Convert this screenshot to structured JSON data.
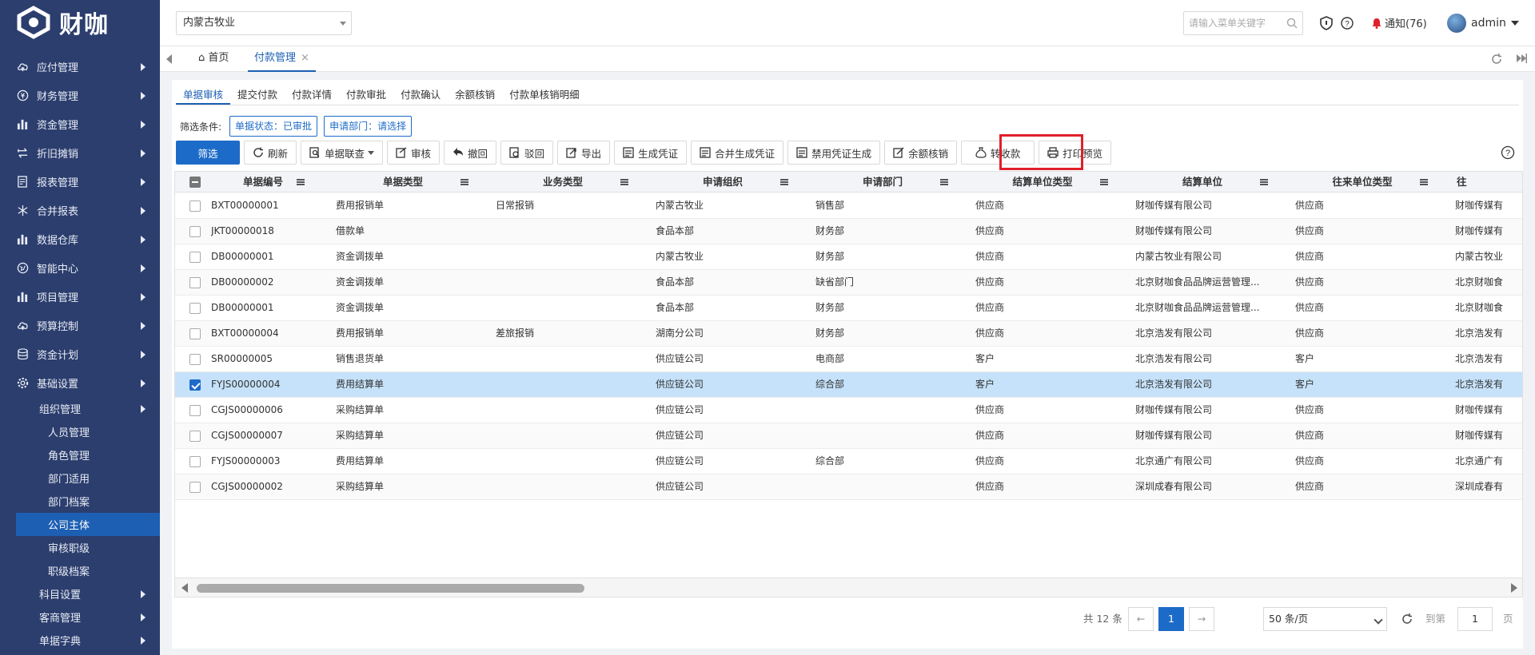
{
  "app": {
    "name": "财咖"
  },
  "sidebar": {
    "top_items": [
      {
        "label": "应付管理",
        "icon": "cloud-icon"
      },
      {
        "label": "财务管理",
        "icon": "coin-icon"
      },
      {
        "label": "资金管理",
        "icon": "bar-chart-icon"
      },
      {
        "label": "折旧摊销",
        "icon": "exchange-icon"
      },
      {
        "label": "报表管理",
        "icon": "report-icon"
      },
      {
        "label": "合并报表",
        "icon": "merge-icon"
      },
      {
        "label": "数据仓库",
        "icon": "bar-chart-icon"
      },
      {
        "label": "智能中心",
        "icon": "globe-icon"
      },
      {
        "label": "项目管理",
        "icon": "bar-chart-icon"
      },
      {
        "label": "预算控制",
        "icon": "cloud-icon"
      },
      {
        "label": "资金计划",
        "icon": "database-icon"
      },
      {
        "label": "基础设置",
        "icon": "gear-icon"
      }
    ],
    "org_group": "组织管理",
    "org_items": [
      "人员管理",
      "角色管理",
      "部门适用",
      "部门档案",
      "公司主体",
      "审核职级",
      "职级档案"
    ],
    "active_item": "公司主体",
    "bottom_items": [
      "科目设置",
      "客商管理",
      "单据字典"
    ]
  },
  "topbar": {
    "org_selected": "内蒙古牧业",
    "search_placeholder": "请输入菜单关键字",
    "notify_label": "通知(76)",
    "user": "admin"
  },
  "tabs": {
    "home": "首页",
    "active": "付款管理",
    "close": "×"
  },
  "subtabs": [
    "单据审核",
    "提交付款",
    "付款详情",
    "付款审批",
    "付款确认",
    "余额核销",
    "付款单核销明细"
  ],
  "filters": {
    "label": "筛选条件:",
    "chips": [
      "单据状态：已审批",
      "申请部门：请选择"
    ]
  },
  "toolbar": {
    "filter": "筛选",
    "refresh": "刷新",
    "query": "单据联查",
    "audit": "审核",
    "revoke": "撤回",
    "reject": "驳回",
    "export": "导出",
    "gen_voucher": "生成凭证",
    "merge_voucher": "合并生成凭证",
    "disable_voucher": "禁用凭证生成",
    "balance_writeoff": "余额核销",
    "to_receipt": "转收款",
    "print_preview": "打印预览"
  },
  "table": {
    "columns": [
      "单据编号",
      "单据类型",
      "业务类型",
      "申请组织",
      "申请部门",
      "结算单位类型",
      "结算单位",
      "往来单位类型",
      "往"
    ],
    "rows": [
      [
        "BXT00000001",
        "费用报销单",
        "日常报销",
        "内蒙古牧业",
        "销售部",
        "供应商",
        "财咖传媒有限公司",
        "供应商",
        "财咖传媒有"
      ],
      [
        "JKT00000018",
        "借款单",
        "",
        "食品本部",
        "财务部",
        "供应商",
        "财咖传媒有限公司",
        "供应商",
        "财咖传媒有"
      ],
      [
        "DB00000001",
        "资金调拨单",
        "",
        "内蒙古牧业",
        "财务部",
        "供应商",
        "内蒙古牧业有限公司",
        "供应商",
        "内蒙古牧业"
      ],
      [
        "DB00000002",
        "资金调拨单",
        "",
        "食品本部",
        "缺省部门",
        "供应商",
        "北京财咖食品品牌运营管理...",
        "供应商",
        "北京财咖食"
      ],
      [
        "DB00000001",
        "资金调拨单",
        "",
        "食品本部",
        "财务部",
        "供应商",
        "北京财咖食品品牌运营管理...",
        "供应商",
        "北京财咖食"
      ],
      [
        "BXT00000004",
        "费用报销单",
        "差旅报销",
        "湖南分公司",
        "财务部",
        "供应商",
        "北京浩发有限公司",
        "供应商",
        "北京浩发有"
      ],
      [
        "SR00000005",
        "销售退货单",
        "",
        "供应链公司",
        "电商部",
        "客户",
        "北京浩发有限公司",
        "客户",
        "北京浩发有"
      ],
      [
        "FYJS00000004",
        "费用结算单",
        "",
        "供应链公司",
        "综合部",
        "客户",
        "北京浩发有限公司",
        "客户",
        "北京浩发有"
      ],
      [
        "CGJS00000006",
        "采购结算单",
        "",
        "供应链公司",
        "",
        "供应商",
        "财咖传媒有限公司",
        "供应商",
        "财咖传媒有"
      ],
      [
        "CGJS00000007",
        "采购结算单",
        "",
        "供应链公司",
        "",
        "供应商",
        "财咖传媒有限公司",
        "供应商",
        "财咖传媒有"
      ],
      [
        "FYJS00000003",
        "费用结算单",
        "",
        "供应链公司",
        "综合部",
        "供应商",
        "北京通广有限公司",
        "供应商",
        "北京通广有"
      ],
      [
        "CGJS00000002",
        "采购结算单",
        "",
        "供应链公司",
        "",
        "供应商",
        "深圳成春有限公司",
        "供应商",
        "深圳成春有"
      ]
    ],
    "selected_row": 7
  },
  "pager": {
    "total": "共 12 条",
    "prev": "←",
    "page": "1",
    "next": "→",
    "size": "50 条/页",
    "goto": "到第",
    "goto_value": "1",
    "page_unit": "页"
  },
  "colors": {
    "sidebar_bg": "#2c3e6e",
    "accent": "#1d6bc8",
    "highlight": "#e0202a"
  }
}
